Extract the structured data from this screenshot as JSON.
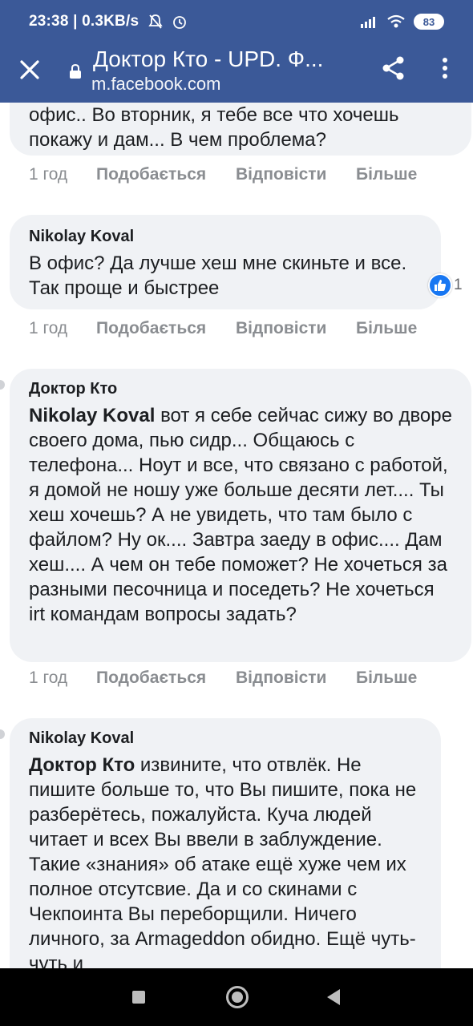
{
  "status_bar": {
    "time": "23:38",
    "net_speed": "0.3KB/s",
    "battery": "83"
  },
  "header": {
    "title": "Доктор Кто - UPD. Ф...",
    "url": "m.facebook.com"
  },
  "actions": {
    "time": "1 год",
    "like": "Подобається",
    "reply": "Відповісти",
    "more": "Більше"
  },
  "comments": [
    {
      "author": "",
      "mention": "",
      "text": "офис.. Во вторник, я тебе все что хочешь покажу и дам... В чем проблема?"
    },
    {
      "author": "Nikolay Koval",
      "mention": "",
      "text": "В офис? Да лучше хеш мне скиньте и все. Так проще и быстрее",
      "reactions": "1"
    },
    {
      "author": "Доктор Кто",
      "mention": "Nikolay Koval",
      "text": " вот я себе сейчас сижу во дворе своего дома, пью сидр... Общаюсь с телефона... Ноут и все, что связано с работой, я домой не ношу уже больше десяти лет.... Ты хеш хочешь? А не увидеть, что там было с файлом? Ну ок.... Завтра заеду в офис.... Дам хеш.... А чем он тебе поможет? Не хочеться за разными песочница и поседеть? Не хочеться irt командам вопросы задать?"
    },
    {
      "author": "Nikolay Koval",
      "mention": "Доктор Кто",
      "text": " извините, что отвлёк. Не пишите больше то, что Вы пишите, пока не разберётесь, пожалуйста. Куча людей читает и всех Вы ввели в заблуждение. Такие «знания» об атаке ещё хуже чем их полное отсутсвие. Да и со скинами с Чекпоинта Вы переборщили. Ничего личного, за Armageddon обидно. Ещё чуть-чуть и"
    }
  ],
  "icons": {
    "close": "close-icon",
    "lock": "lock-icon",
    "share": "share-icon",
    "menu": "more-vert-icon",
    "like": "like-icon",
    "nav_recent": "recent-apps-icon",
    "nav_home": "home-icon",
    "nav_back": "back-icon"
  },
  "colors": {
    "brand": "#3b5998",
    "bubble": "#f0f2f5",
    "muted": "#8a8d91",
    "like": "#1877f2"
  }
}
